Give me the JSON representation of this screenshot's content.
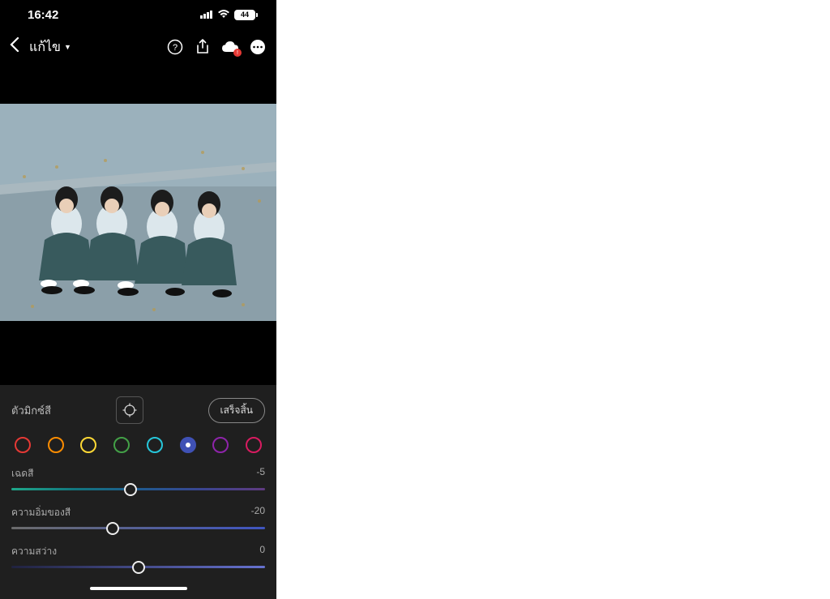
{
  "status": {
    "time": "16:42",
    "battery": "44"
  },
  "toolbar": {
    "title": "แก้ไข"
  },
  "panel": {
    "title": "ตัวมิกซ์สี",
    "done_label": "เสร็จสิ้น"
  },
  "colors": [
    {
      "name": "red",
      "hex": "#e53935",
      "selected": false
    },
    {
      "name": "orange",
      "hex": "#fb8c00",
      "selected": false
    },
    {
      "name": "yellow",
      "hex": "#fdd835",
      "selected": false
    },
    {
      "name": "green",
      "hex": "#43a047",
      "selected": false
    },
    {
      "name": "aqua",
      "hex": "#26c6da",
      "selected": false
    },
    {
      "name": "blue",
      "hex": "#3f51b5",
      "selected": true
    },
    {
      "name": "purple",
      "hex": "#8e24aa",
      "selected": false
    },
    {
      "name": "magenta",
      "hex": "#d81b60",
      "selected": false
    }
  ],
  "sliders": {
    "hue": {
      "label": "เฉดสี",
      "value": "-5",
      "pos": 47
    },
    "saturation": {
      "label": "ความอิ่มของสี",
      "value": "-20",
      "pos": 40
    },
    "luminance": {
      "label": "ความสว่าง",
      "value": "0",
      "pos": 50
    }
  }
}
